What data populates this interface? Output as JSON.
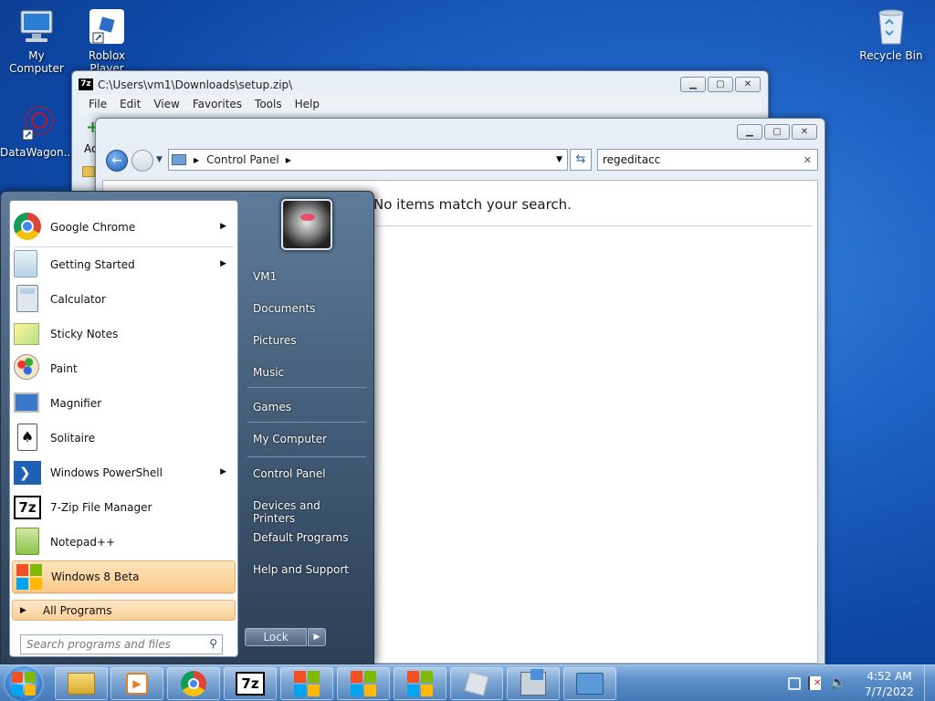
{
  "desktop": {
    "icons": [
      {
        "label": "My Computer"
      },
      {
        "label": "Roblox Player"
      },
      {
        "label": "DataWagon..."
      },
      {
        "label": "Recycle Bin"
      }
    ]
  },
  "zip_window": {
    "title": "C:\\Users\\vm1\\Downloads\\setup.zip\\",
    "menu": [
      "File",
      "Edit",
      "View",
      "Favorites",
      "Tools",
      "Help"
    ],
    "partial_label": "Ac"
  },
  "cp_window": {
    "breadcrumb": "Control Panel",
    "search_value": "regeditacc",
    "message": "No items match your search."
  },
  "start_menu": {
    "left_items": [
      {
        "label": "Google Chrome",
        "icon": "chrome-icon",
        "submenu": true
      },
      {
        "label": "Getting Started",
        "icon": "getting-started-icon",
        "submenu": true
      },
      {
        "label": "Calculator",
        "icon": "calculator-icon",
        "submenu": false
      },
      {
        "label": "Sticky Notes",
        "icon": "sticky-notes-icon",
        "submenu": false
      },
      {
        "label": "Paint",
        "icon": "paint-icon",
        "submenu": false
      },
      {
        "label": "Magnifier",
        "icon": "magnifier-icon",
        "submenu": false
      },
      {
        "label": "Solitaire",
        "icon": "solitaire-icon",
        "submenu": false
      },
      {
        "label": "Windows PowerShell",
        "icon": "powershell-icon",
        "submenu": true
      },
      {
        "label": "7-Zip File Manager",
        "icon": "7zip-icon",
        "submenu": false
      },
      {
        "label": "Notepad++",
        "icon": "notepadpp-icon",
        "submenu": false
      },
      {
        "label": "Windows 8 Beta",
        "icon": "windows-icon",
        "submenu": false
      }
    ],
    "all_programs": "All Programs",
    "search_placeholder": "Search programs and files",
    "right_items": [
      {
        "label": "VM1"
      },
      {
        "label": "Documents"
      },
      {
        "label": "Pictures"
      },
      {
        "label": "Music"
      },
      {
        "label": "Games"
      },
      {
        "label": "My Computer"
      },
      {
        "label": "Control Panel"
      },
      {
        "label": "Devices and Printers"
      },
      {
        "label": "Default Programs"
      },
      {
        "label": "Help and Support"
      }
    ],
    "lock_label": "Lock"
  },
  "taskbar": {
    "time": "4:52 AM",
    "date": "7/7/2022",
    "pinned": [
      "file-explorer-icon",
      "media-player-icon",
      "chrome-icon",
      "7zip-icon",
      "windows-icon",
      "windows-icon",
      "windows-icon",
      "roblox-icon",
      "installer-icon",
      "control-panel-icon"
    ]
  }
}
